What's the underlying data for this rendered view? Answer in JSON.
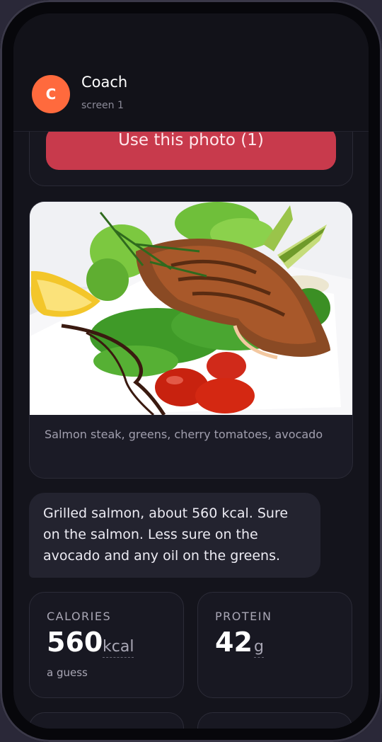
{
  "header": {
    "avatar_letter": "C",
    "title": "Coach",
    "subtitle": "screen 1"
  },
  "photo_action": {
    "use_label": "Use this photo (1)"
  },
  "image_card": {
    "image_icon": "food-photo",
    "caption": "Salmon steak, greens, cherry tomatoes, avocado"
  },
  "message": {
    "text": "Grilled salmon, about 560 kcal. Sure on the salmon. Less sure on the avocado and any oil on the greens."
  },
  "stats": {
    "calories": {
      "label": "CALORIES",
      "value": "560",
      "unit": "kcal",
      "note": "a guess"
    },
    "protein": {
      "label": "PROTEIN",
      "value": "42",
      "unit": "g"
    }
  },
  "colors": {
    "accent": "#ff6a3d",
    "button": "#c83a4c",
    "background": "#14141c"
  }
}
